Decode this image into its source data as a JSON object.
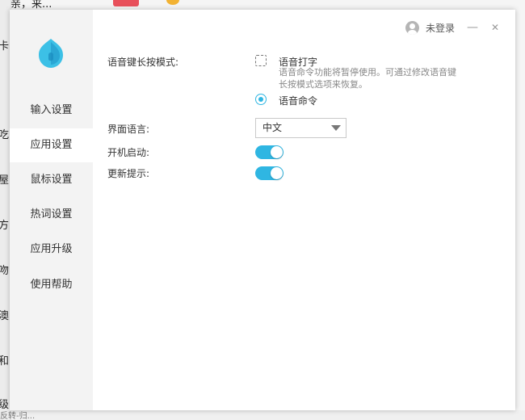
{
  "background_app": {
    "top_text": "家亲，来...",
    "left_lines": [
      "卡",
      "吃",
      "屋",
      "方",
      "吻",
      "澳",
      "和",
      "级"
    ],
    "bottom_text": "反转-归..."
  },
  "dialog": {
    "user": {
      "login_label": "未登录"
    },
    "window_controls": {
      "minimize": "—",
      "close": "✕"
    },
    "nav": [
      {
        "label": "输入设置"
      },
      {
        "label": "应用设置",
        "active": true
      },
      {
        "label": "鼠标设置"
      },
      {
        "label": "热词设置"
      },
      {
        "label": "应用升级"
      },
      {
        "label": "使用帮助"
      }
    ],
    "settings": {
      "voice_mode": {
        "label": "语音键长按模式:",
        "option_typing": "语音打字",
        "option_typing_desc": "语音命令功能将暂停使用。可通过修改语音键长按模式选项来恢复。",
        "option_command": "语音命令",
        "selected": "语音命令"
      },
      "ui_language": {
        "label": "界面语言:",
        "value": "中文"
      },
      "startup": {
        "label": "开机启动:",
        "enabled": true
      },
      "update_notice": {
        "label": "更新提示:",
        "enabled": true
      }
    },
    "colors": {
      "accent": "#2fb6e2",
      "sidebar_bg": "#f3f3f3",
      "logo": "#3cc0e6"
    },
    "icons": [
      "app-logo-icon",
      "user-avatar-icon",
      "minimize-icon",
      "close-icon",
      "dropdown-caret-icon"
    ]
  }
}
